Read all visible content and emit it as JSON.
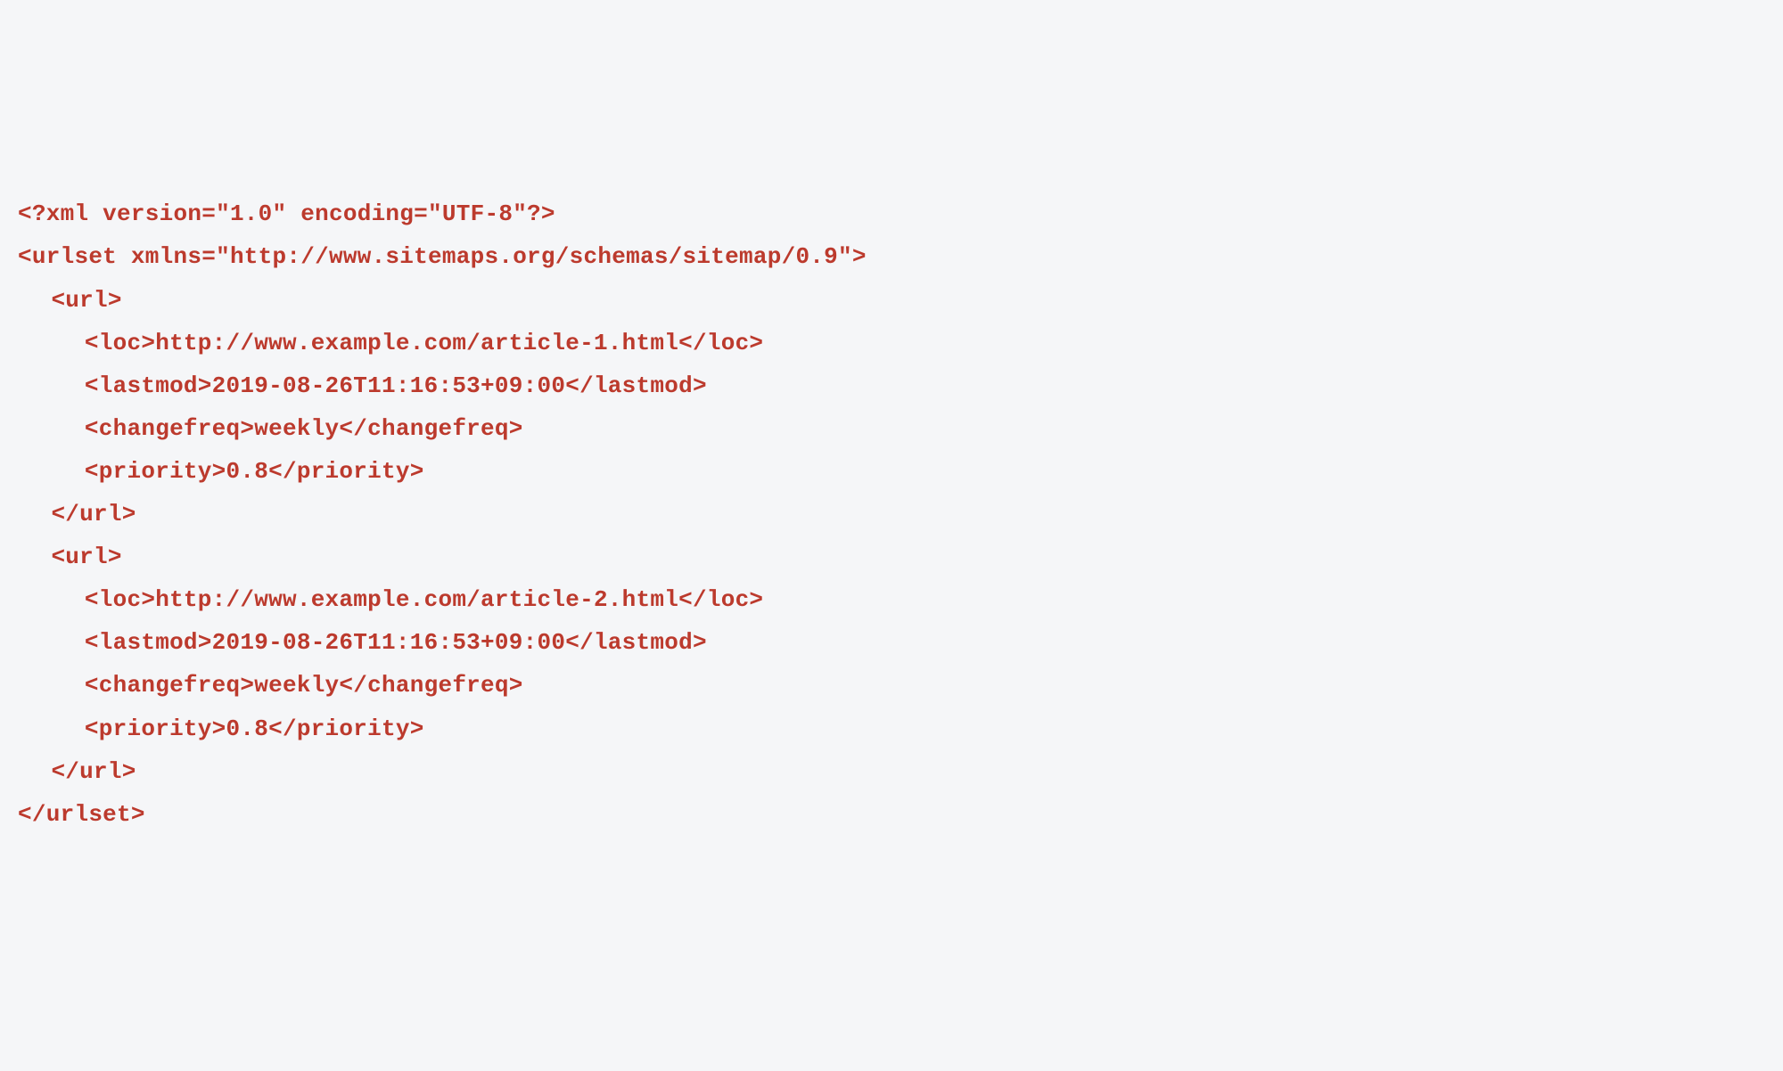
{
  "code": {
    "lines": [
      {
        "indent": 0,
        "text": "<?xml version=\"1.0\" encoding=\"UTF-8\"?>"
      },
      {
        "indent": 0,
        "text": "<urlset xmlns=\"http://www.sitemaps.org/schemas/sitemap/0.9\">"
      },
      {
        "indent": 1,
        "text": "<url>"
      },
      {
        "indent": 2,
        "text": "<loc>http://www.example.com/article-1.html</loc>"
      },
      {
        "indent": 2,
        "text": "<lastmod>2019-08-26T11:16:53+09:00</lastmod>"
      },
      {
        "indent": 2,
        "text": "<changefreq>weekly</changefreq>"
      },
      {
        "indent": 2,
        "text": "<priority>0.8</priority>"
      },
      {
        "indent": 1,
        "text": "</url>"
      },
      {
        "indent": 1,
        "text": "<url>"
      },
      {
        "indent": 2,
        "text": "<loc>http://www.example.com/article-2.html</loc>"
      },
      {
        "indent": 2,
        "text": "<lastmod>2019-08-26T11:16:53+09:00</lastmod>"
      },
      {
        "indent": 2,
        "text": "<changefreq>weekly</changefreq>"
      },
      {
        "indent": 2,
        "text": "<priority>0.8</priority>"
      },
      {
        "indent": 1,
        "text": "</url>"
      },
      {
        "indent": 0,
        "text": "</urlset>"
      }
    ]
  }
}
